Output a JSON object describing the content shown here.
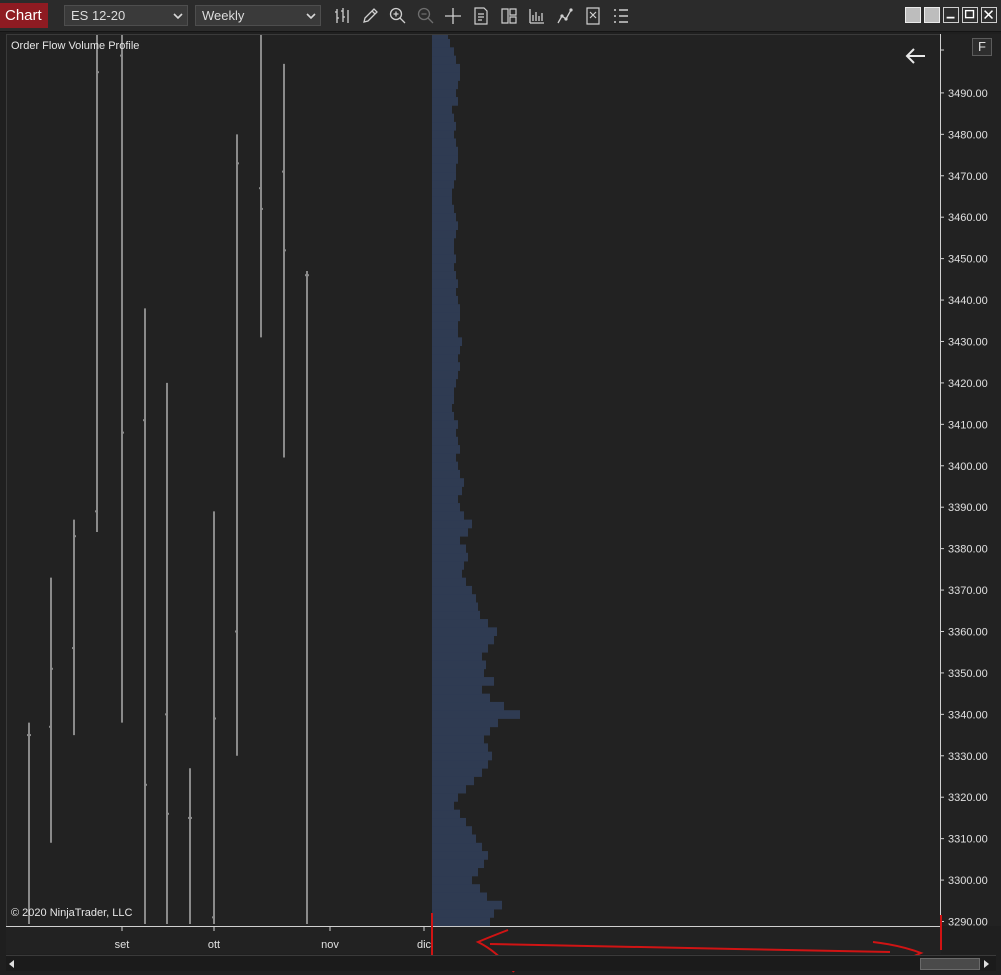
{
  "toolbar": {
    "tab_label": "Chart",
    "instrument": "ES 12-20",
    "interval": "Weekly",
    "tools": [
      "bar-type-icon",
      "drawing-pencil-icon",
      "zoom-in-icon",
      "zoom-out-icon",
      "crosshair-icon",
      "data-box-icon",
      "properties-icon",
      "indicators-icon",
      "strategies-icon",
      "chart-trader-icon",
      "more-menu-icon"
    ]
  },
  "chart": {
    "indicator_label": "Order Flow Volume Profile",
    "copyright": "© 2020 NinjaTrader, LLC",
    "f_button": "F",
    "colors": {
      "background": "#222222",
      "bars": "#8a8a8a",
      "profile": "#2f3b52",
      "annotation": "#d01414"
    }
  },
  "chart_data": {
    "type": "bar",
    "subtype": "ohlc-with-volume-profile",
    "y_axis": {
      "ylim": [
        3287.5,
        3511
      ],
      "ticks": [
        3290,
        3300,
        3310,
        3320,
        3330,
        3340,
        3350,
        3360,
        3370,
        3380,
        3390,
        3400,
        3410,
        3420,
        3430,
        3440,
        3450,
        3460,
        3470,
        3480,
        3490
      ],
      "tick_labels": [
        "3290.00",
        "3300.00",
        "3310.00",
        "3320.00",
        "3330.00",
        "3340.00",
        "3350.00",
        "3360.00",
        "3370.00",
        "3380.00",
        "3390.00",
        "3400.00",
        "3410.00",
        "3420.00",
        "3430.00",
        "3440.00",
        "3450.00",
        "3460.00",
        "3470.00",
        "3480.00",
        "3490.00"
      ]
    },
    "x_axis": {
      "tick_labels": [
        "set",
        "ott",
        "nov",
        "dic"
      ]
    },
    "series": [
      {
        "kind": "ohlc",
        "bars": [
          {
            "high": 3338,
            "low": 3288,
            "open": 3335,
            "close": 3335
          },
          {
            "high": 3373,
            "low": 3309,
            "open": 3337,
            "close": 3351
          },
          {
            "high": 3387,
            "low": 3335,
            "open": 3356,
            "close": 3383
          },
          {
            "high": 3511,
            "low": 3384,
            "open": 3389,
            "close": 3495
          },
          {
            "high": 3511,
            "low": 3338,
            "open": 3499,
            "close": 3408
          },
          {
            "high": 3438,
            "low": 3288,
            "open": 3411,
            "close": 3323
          },
          {
            "high": 3420,
            "low": 3288,
            "open": 3340,
            "close": 3316
          },
          {
            "high": 3327,
            "low": 3288,
            "open": 3315,
            "close": 3315
          },
          {
            "high": 3389,
            "low": 3288,
            "open": 3291,
            "close": 3339
          },
          {
            "high": 3480,
            "low": 3330,
            "open": 3360,
            "close": 3473
          },
          {
            "high": 3511,
            "low": 3431,
            "open": 3467,
            "close": 3462
          },
          {
            "high": 3497,
            "low": 3402,
            "open": 3471,
            "close": 3452
          },
          {
            "high": 3447,
            "low": 3288,
            "open": 3446,
            "close": 3446
          }
        ]
      },
      {
        "kind": "volume-profile",
        "prices": [
          3290,
          3292,
          3294,
          3296,
          3298,
          3300,
          3302,
          3304,
          3306,
          3308,
          3310,
          3312,
          3314,
          3316,
          3318,
          3320,
          3322,
          3324,
          3326,
          3328,
          3330,
          3332,
          3334,
          3336,
          3338,
          3340,
          3342,
          3344,
          3346,
          3348,
          3350,
          3352,
          3354,
          3356,
          3358,
          3360,
          3362,
          3364,
          3366,
          3368,
          3370,
          3372,
          3374,
          3376,
          3378,
          3380,
          3382,
          3384,
          3386,
          3388,
          3390,
          3392,
          3394,
          3396,
          3398,
          3400,
          3402,
          3404,
          3406,
          3408,
          3410,
          3412,
          3414,
          3416,
          3418,
          3420,
          3422,
          3424,
          3426,
          3428,
          3430,
          3432,
          3434,
          3436,
          3438,
          3440,
          3442,
          3444,
          3446,
          3448,
          3450,
          3452,
          3454,
          3456,
          3458,
          3460,
          3462,
          3464,
          3466,
          3468,
          3470,
          3472,
          3474,
          3476,
          3478,
          3480,
          3482,
          3484,
          3486,
          3488,
          3490,
          3492,
          3494,
          3496,
          3498,
          3500,
          3502,
          3504,
          3506,
          3508,
          3510
        ],
        "volumes": [
          58,
          62,
          70,
          55,
          48,
          40,
          46,
          52,
          56,
          50,
          44,
          40,
          34,
          28,
          22,
          26,
          34,
          42,
          50,
          56,
          60,
          56,
          52,
          58,
          66,
          88,
          72,
          58,
          50,
          62,
          52,
          54,
          50,
          56,
          62,
          65,
          56,
          48,
          46,
          44,
          40,
          34,
          30,
          32,
          36,
          34,
          28,
          36,
          40,
          32,
          28,
          26,
          30,
          32,
          28,
          26,
          24,
          28,
          26,
          24,
          26,
          22,
          20,
          22,
          22,
          24,
          26,
          28,
          26,
          28,
          30,
          26,
          26,
          28,
          28,
          26,
          24,
          26,
          24,
          22,
          24,
          22,
          22,
          24,
          26,
          24,
          22,
          20,
          20,
          22,
          24,
          24,
          26,
          26,
          24,
          22,
          24,
          22,
          20,
          26,
          24,
          26,
          28,
          28,
          24,
          22,
          18,
          16,
          14,
          12,
          10
        ]
      }
    ],
    "grid": false,
    "legend": "none"
  }
}
